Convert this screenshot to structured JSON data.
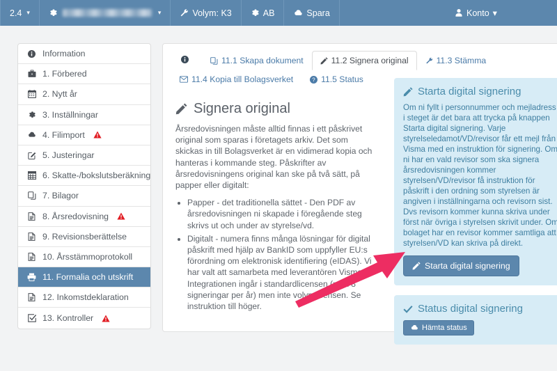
{
  "topbar": {
    "version": "2.4",
    "company_name_redacted": "",
    "items": [
      {
        "label": "Volym: K3",
        "icon": "wrench-icon"
      },
      {
        "label": "AB",
        "icon": "gear-icon"
      },
      {
        "label": "Spara",
        "icon": "cloud-save-icon"
      }
    ],
    "account_label": "Konto"
  },
  "sidebar": {
    "items": [
      {
        "label": "Information",
        "icon": "info-icon",
        "warning": false,
        "active": false
      },
      {
        "label": "1. Förbered",
        "icon": "briefcase-icon",
        "warning": false,
        "active": false
      },
      {
        "label": "2. Nytt år",
        "icon": "calendar-icon",
        "warning": false,
        "active": false
      },
      {
        "label": "3. Inställningar",
        "icon": "gear-icon",
        "warning": false,
        "active": false
      },
      {
        "label": "4. Filimport",
        "icon": "cloud-icon",
        "warning": true,
        "active": false
      },
      {
        "label": "5. Justeringar",
        "icon": "edit-square-icon",
        "warning": false,
        "active": false
      },
      {
        "label": "6. Skatte-/bokslutsberäkning",
        "icon": "calculator-icon",
        "warning": false,
        "active": false
      },
      {
        "label": "7. Bilagor",
        "icon": "copy-icon",
        "warning": false,
        "active": false
      },
      {
        "label": "8. Årsredovisning",
        "icon": "document-icon",
        "warning": true,
        "active": false
      },
      {
        "label": "9. Revisionsberättelse",
        "icon": "document-icon",
        "warning": false,
        "active": false
      },
      {
        "label": "10. Årsstämmoprotokoll",
        "icon": "document-icon",
        "warning": false,
        "active": false
      },
      {
        "label": "11. Formalia och utskrift",
        "icon": "printer-icon",
        "warning": false,
        "active": true
      },
      {
        "label": "12. Inkomstdeklaration",
        "icon": "document-icon",
        "warning": false,
        "active": false
      },
      {
        "label": "13. Kontroller",
        "icon": "checkbox-icon",
        "warning": true,
        "active": false
      }
    ]
  },
  "tabs": [
    {
      "label": "",
      "icon": "info-icon",
      "active": false
    },
    {
      "label": "11.1 Skapa dokument",
      "icon": "copy-icon",
      "active": false
    },
    {
      "label": "11.2 Signera original",
      "icon": "pencil-icon",
      "active": true
    },
    {
      "label": "11.3 Stämma",
      "icon": "gavel-icon",
      "active": false
    },
    {
      "label": "11.4 Kopia till Bolagsverket",
      "icon": "envelope-icon",
      "active": false
    },
    {
      "label": "11.5 Status",
      "icon": "question-icon",
      "active": false
    }
  ],
  "main": {
    "title": "Signera original",
    "title_icon": "pencil-icon",
    "intro": "Årsredovisningen måste alltid finnas i ett påskrivet original som sparas i företagets arkiv. Det som skickas in till Bolagsverket är en vidimerad kopia och hanteras i kommande steg. Påskrifter av årsredovisningens original kan ske på två sätt, på papper eller digitalt:",
    "bullets": [
      "Papper - det traditionella sättet - Den PDF av årsredovisningen ni skapade i föregående steg skrivs ut och under av styrelse/vd.",
      "Digitalt - numera finns många lösningar för digital påskrift med hjälp av BankID som uppfyller EU:s förordning om elektronisk identifiering (eIDAS). Vi har valt att samarbeta med leverantören Visma. Integrationen ingår i standardlicensen (max 8 signeringar per år) men inte volymlicensen. Se instruktion till höger."
    ]
  },
  "panels": {
    "start": {
      "title": "Starta digital signering",
      "title_icon": "pencil-icon",
      "text": "Om ni fyllt i personnummer och mejladress i steget är det bara att trycka på knappen Starta digital signering. Varje styrelseledamot/VD/revisor får ett mejl från Visma med en instruktion för signering. Om ni har en vald revisor som ska signera årsredovisningen kommer styrelsen/VD/revisor få instruktion för påskrift i den ordning som styrelsen är angiven i inställningarna och revisorn sist. Dvs revisorn kommer kunna skriva under först när övriga i styrelsen skrivit under. Om bolaget har en revisor kommer samtliga att styrelsen/VD kan skriva på direkt.",
      "button_label": "Starta digital signering",
      "button_icon": "pencil-icon"
    },
    "status": {
      "title": "Status digital signering",
      "title_icon": "check-icon",
      "button_label": "Hämta status",
      "button_icon": "cloud-download-icon"
    }
  },
  "annotation": {
    "type": "arrow",
    "color": "#ed2d62",
    "points_to": "Starta digital signering"
  },
  "colors": {
    "brand_blue": "#5c87ad",
    "panel_bg": "#d7ecf6",
    "panel_text": "#3e7ea0",
    "warning_red": "#e11b22",
    "arrow_pink": "#ed2d62"
  }
}
